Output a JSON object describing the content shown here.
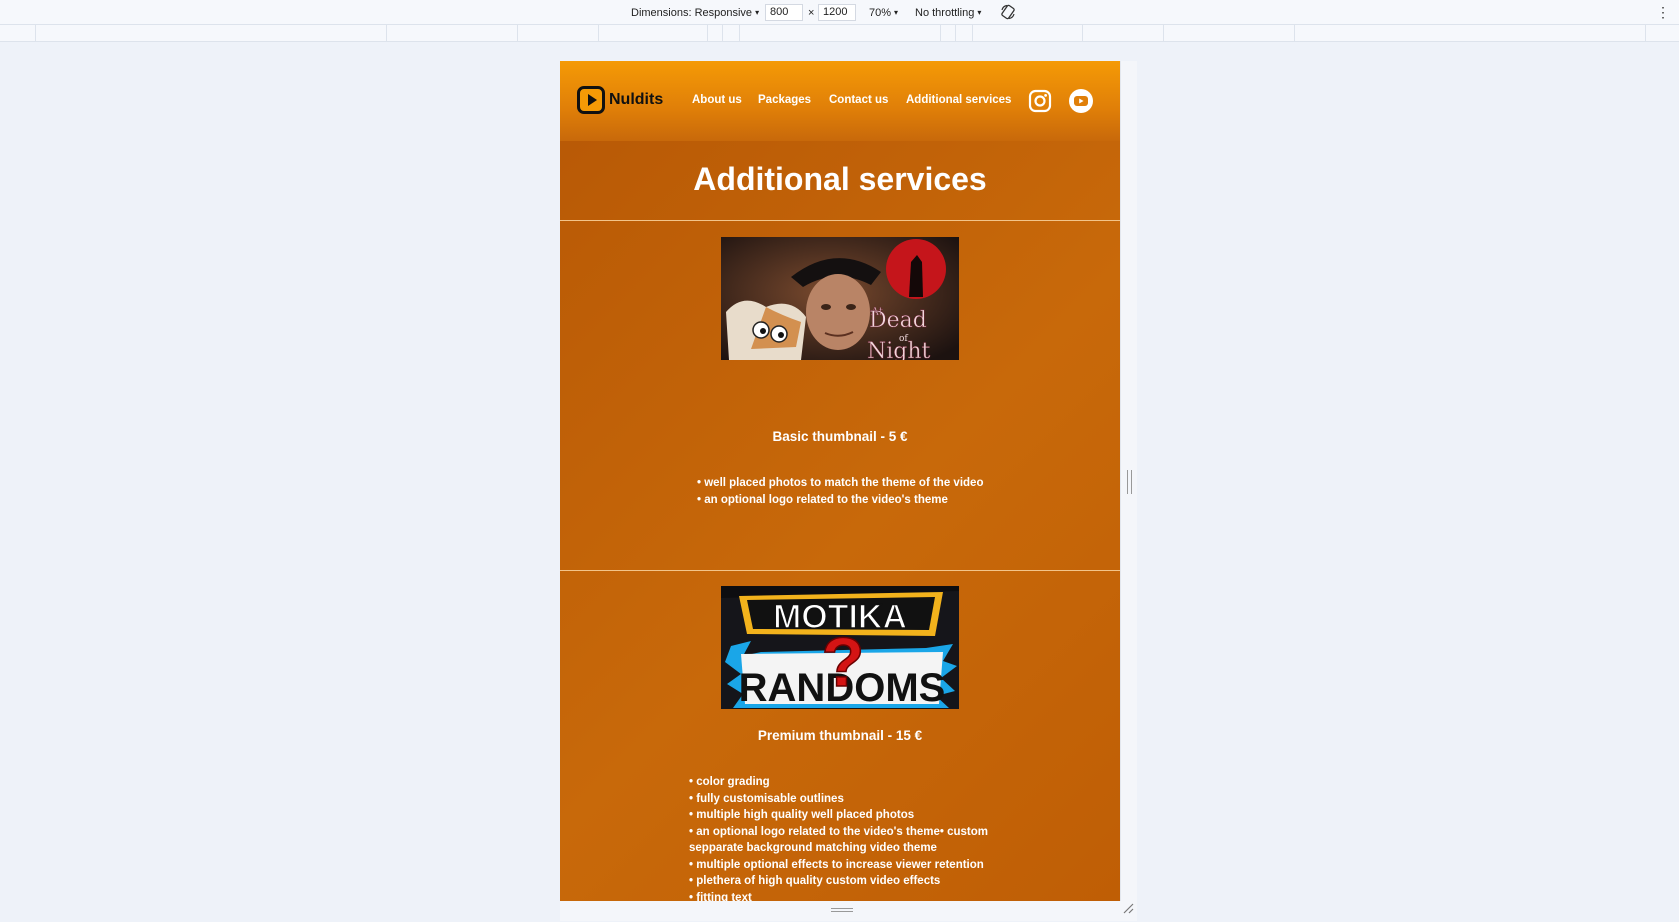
{
  "devtools": {
    "dimensions_label": "Dimensions: Responsive",
    "width_value": "800",
    "times": "×",
    "height_value": "1200",
    "zoom": "70%",
    "throttling": "No throttling",
    "caret": "▾",
    "menu": "⋮"
  },
  "site": {
    "logo_text": "Nuldits",
    "nav": [
      "About us",
      "Packages",
      "Contact us",
      "Additional services"
    ],
    "page_title": "Additional services",
    "services": [
      {
        "title": "Basic thumbnail - 5 €",
        "thumb_text": [
          "At",
          "Dead",
          "of",
          "Night"
        ],
        "features": [
          "well placed photos to match the theme of the video",
          "an optional logo related to the video's theme"
        ]
      },
      {
        "title": "Premium thumbnail - 15 €",
        "thumb_text": [
          "MOTIKA",
          "RANDOMS",
          "?"
        ],
        "features": [
          "color grading",
          "fully customisable outlines",
          "multiple high quality well placed photos",
          "an optional logo related to the video's theme• custom sepparate background matching video theme",
          "multiple optional effects to increase viewer retention",
          "plethera of high quality custom video effects",
          "fitting text"
        ]
      }
    ]
  },
  "colors": {
    "orange_top": "#f59a06",
    "orange_body": "#c8690a",
    "divider": "#f3c489"
  },
  "icons": [
    "rotate-icon",
    "kebab-icon",
    "logo-play-icon",
    "instagram-icon",
    "youtube-icon",
    "resize-corner-icon"
  ]
}
